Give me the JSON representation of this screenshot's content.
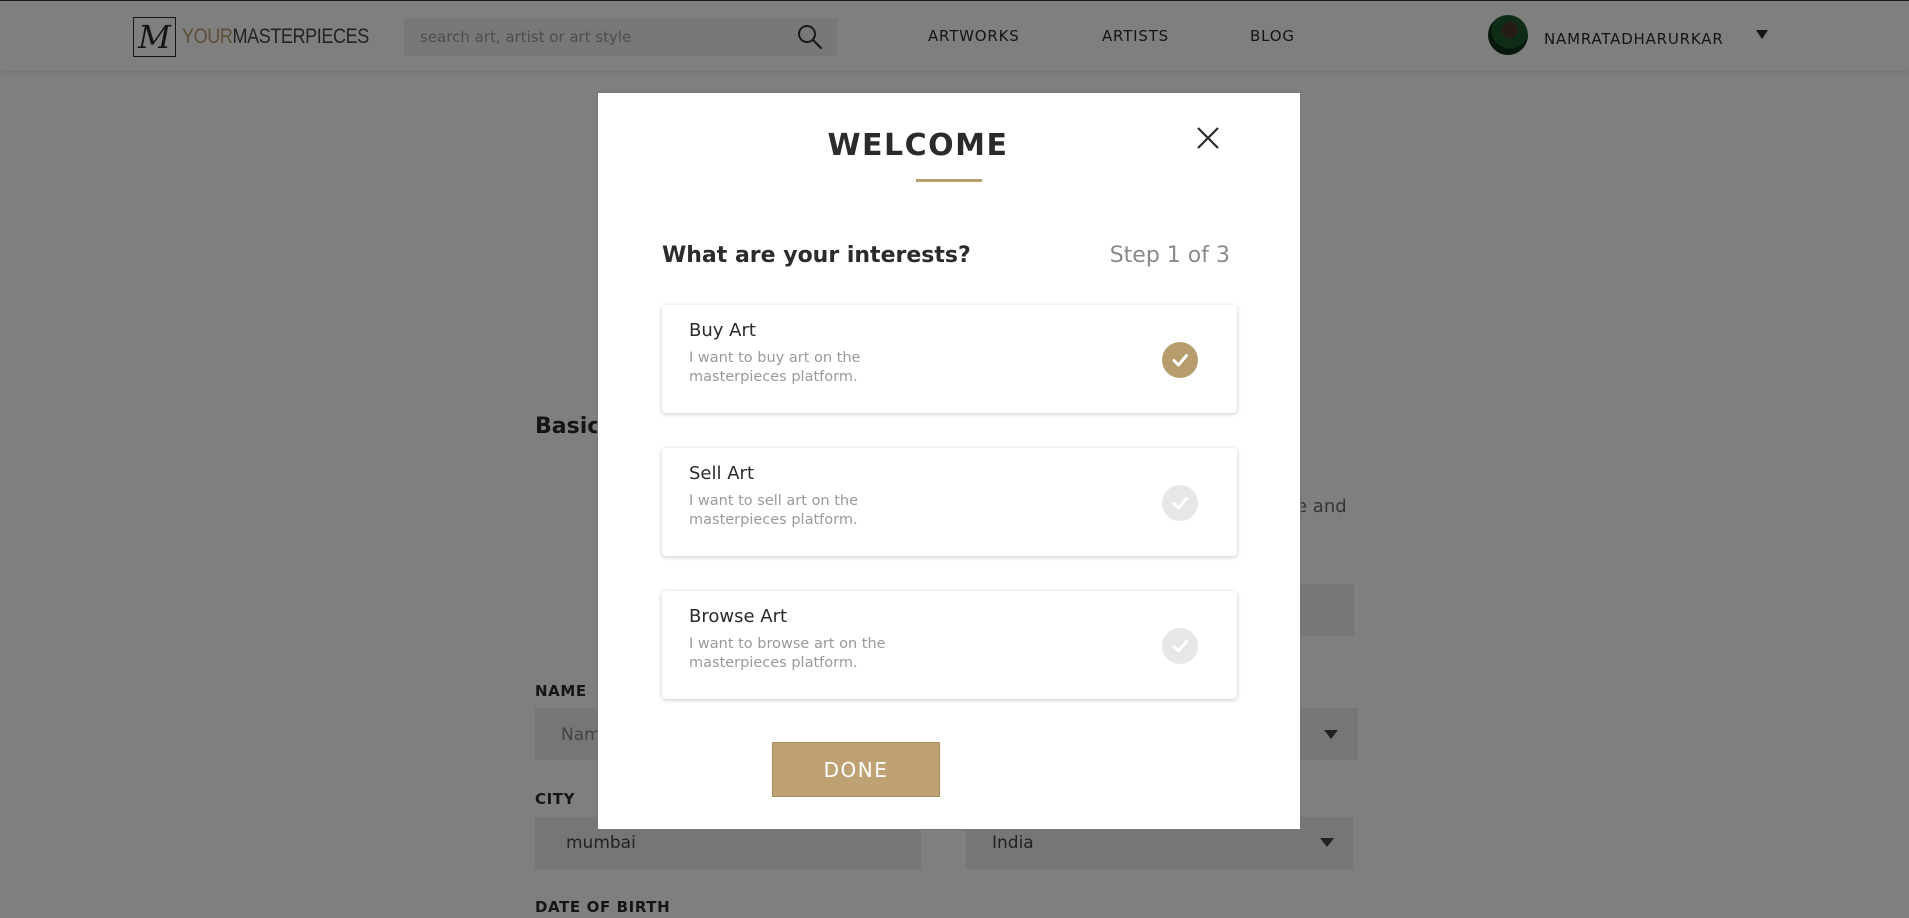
{
  "brand": {
    "your": "YOUR",
    "masterpieces": "MASTERPIECES"
  },
  "search": {
    "placeholder": "search art, artist or art style"
  },
  "nav": {
    "artworks": "ARTWORKS",
    "artists": "ARTISTS",
    "blog": "BLOG"
  },
  "user": {
    "name": "NAMRATADHARURKAR"
  },
  "background_form": {
    "section_title": "Basic",
    "partial_text": "e and",
    "name_label": "NAME",
    "name_value": "Nam",
    "city_label": "CITY",
    "city_value": "mumbai",
    "country_value": "India",
    "dob_label": "DATE OF BIRTH"
  },
  "modal": {
    "title": "WELCOME",
    "question": "What are your interests?",
    "step": "Step 1 of 3",
    "options": [
      {
        "title": "Buy Art",
        "description": "I want to buy art on the masterpieces platform.",
        "selected": true
      },
      {
        "title": "Sell Art",
        "description": "I want to sell art on the masterpieces platform.",
        "selected": false
      },
      {
        "title": "Browse Art",
        "description": "I want to browse art on the masterpieces platform.",
        "selected": false
      }
    ],
    "done_label": "DONE"
  },
  "colors": {
    "accent": "#b89d6c",
    "overlay": "rgba(0,0,0,0.5)"
  }
}
